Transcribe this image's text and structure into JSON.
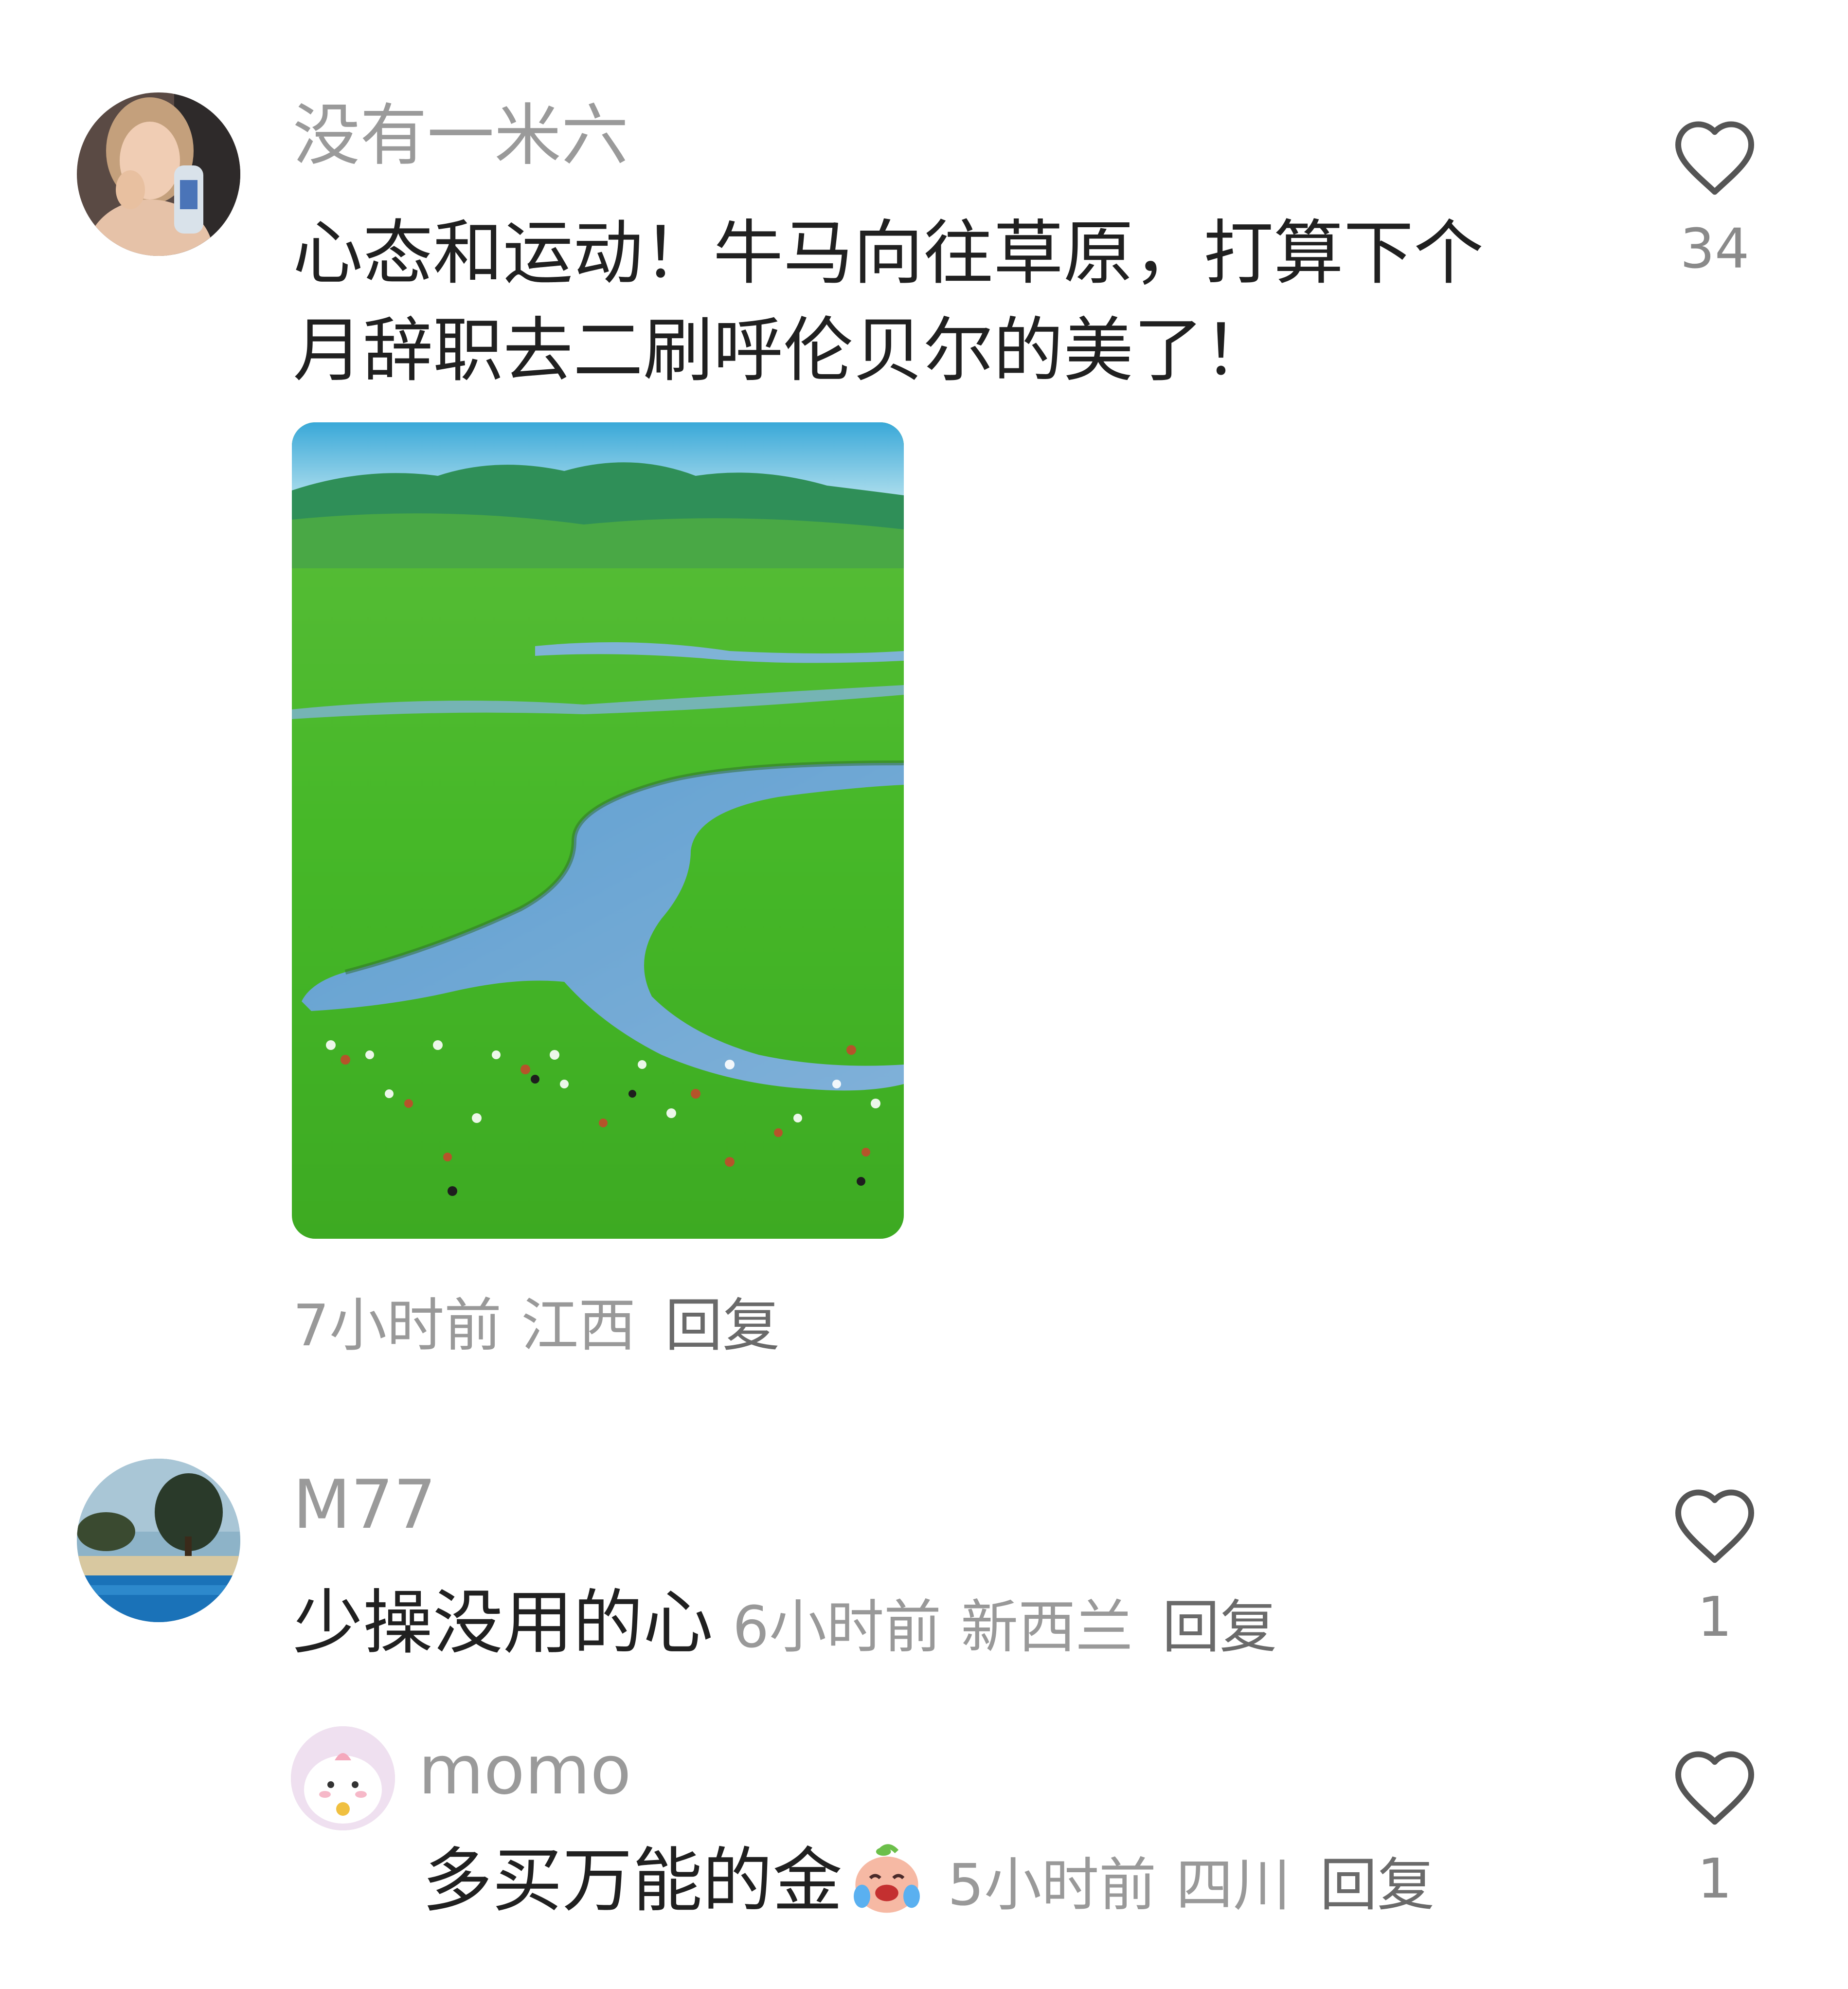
{
  "comments": [
    {
      "username": "没有一米六",
      "text_line1": "心态和运动！牛马向往草原，打算下个",
      "text_line2": "月辞职去二刷呼伦贝尔的美了！",
      "time": "7小时前",
      "location": "江西",
      "reply_label": "回复",
      "likes": "34",
      "avatar_icon": "user-avatar-woman-drinking",
      "image_icon": "grassland-river-photo"
    },
    {
      "username": "M77",
      "text": "少操没用的心",
      "time": "6小时前",
      "location": "新西兰",
      "reply_label": "回复",
      "likes": "1",
      "avatar_icon": "user-avatar-beach-pool"
    },
    {
      "username": "momo",
      "text": "多买万能的金",
      "emoji_icon": "crying-laughing-peach-emoji",
      "time": "5小时前",
      "location": "四川",
      "reply_label": "回复",
      "likes": "1",
      "avatar_icon": "user-avatar-cartoon-pink"
    }
  ],
  "colors": {
    "username": "#9a9a9a",
    "text": "#202020",
    "meta": "#999999",
    "reply": "#6a6a6a",
    "heart": "#555555"
  }
}
